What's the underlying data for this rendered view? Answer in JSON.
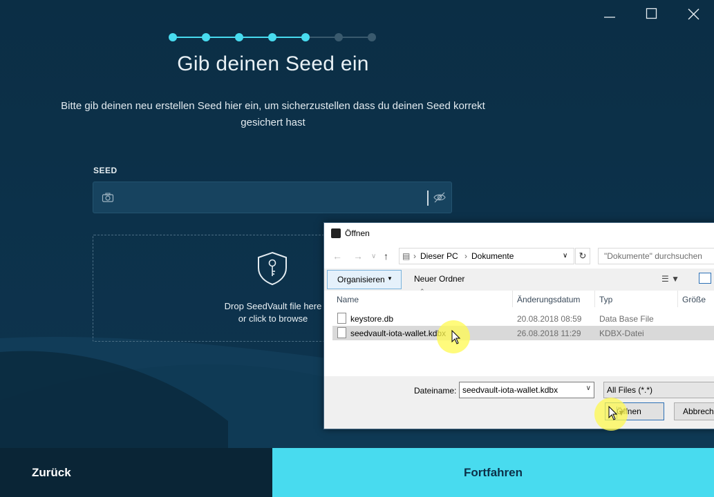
{
  "window_controls": {
    "minimize": "minimize-icon",
    "maximize": "maximize-icon",
    "close": "close-icon"
  },
  "progress": {
    "total_steps": 7,
    "completed_steps": 5,
    "color_done": "#48dbef",
    "color_todo": "#3a5a6e"
  },
  "heading": "Gib deinen Seed ein",
  "description": "Bitte gib deinen neu erstellen Seed hier ein, um sicherzustellen dass du deinen Seed korrekt gesichert hast",
  "seed": {
    "label": "SEED",
    "value": "",
    "camera_icon": "camera-icon",
    "visibility_icon": "eye-slash-icon"
  },
  "dropzone": {
    "line1": "Drop SeedVault file here",
    "line2": "or click to browse",
    "icon": "shield-key-icon"
  },
  "footer": {
    "back": "Zurück",
    "next": "Fortfahren",
    "next_color": "#48dbef"
  },
  "dialog": {
    "title": "Öffnen",
    "breadcrumb": [
      "Dieser PC",
      "Dokumente"
    ],
    "search_placeholder": "\"Dokumente\" durchsuchen",
    "organize": "Organisieren",
    "new_folder": "Neuer Ordner",
    "columns": [
      "Name",
      "Änderungsdatum",
      "Typ",
      "Größe"
    ],
    "files": [
      {
        "name": "keystore.db",
        "date": "20.08.2018 08:59",
        "type": "Data Base File",
        "selected": false
      },
      {
        "name": "seedvault-iota-wallet.kdbx",
        "date": "26.08.2018 11:29",
        "type": "KDBX-Datei",
        "selected": true
      }
    ],
    "filename_label": "Dateiname:",
    "filename_value": "seedvault-iota-wallet.kdbx",
    "filter_value": "All Files (*.*)",
    "open_button": "Öffnen",
    "cancel_button": "Abbrech"
  }
}
